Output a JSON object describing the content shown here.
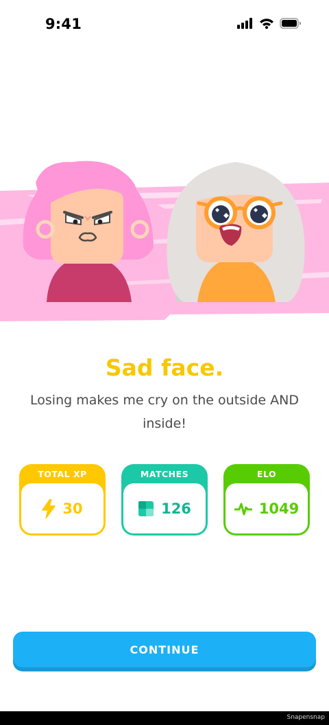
{
  "status_bar": {
    "time": "9:41",
    "icons": [
      "signal-icon",
      "wifi-icon",
      "battery-icon"
    ]
  },
  "hero": {
    "characters": [
      "angry-pink-haired-character",
      "teary-eyed-gray-haired-character"
    ],
    "banner_color": "#ffb8e2"
  },
  "result": {
    "headline": "Sad face.",
    "message": "Losing makes me cry on the outside AND inside!"
  },
  "stats": [
    {
      "label": "TOTAL XP",
      "value": "30",
      "icon": "lightning-bolt-icon",
      "color": "#ffc800"
    },
    {
      "label": "MATCHES",
      "value": "126",
      "icon": "cards-icon",
      "color": "#1cc9a6"
    },
    {
      "label": "ELO",
      "value": "1049",
      "icon": "pulse-icon",
      "color": "#58cc02"
    }
  ],
  "actions": {
    "continue_label": "CONTINUE",
    "continue_color": "#1cb0f6"
  },
  "watermark": "Snapensnap"
}
